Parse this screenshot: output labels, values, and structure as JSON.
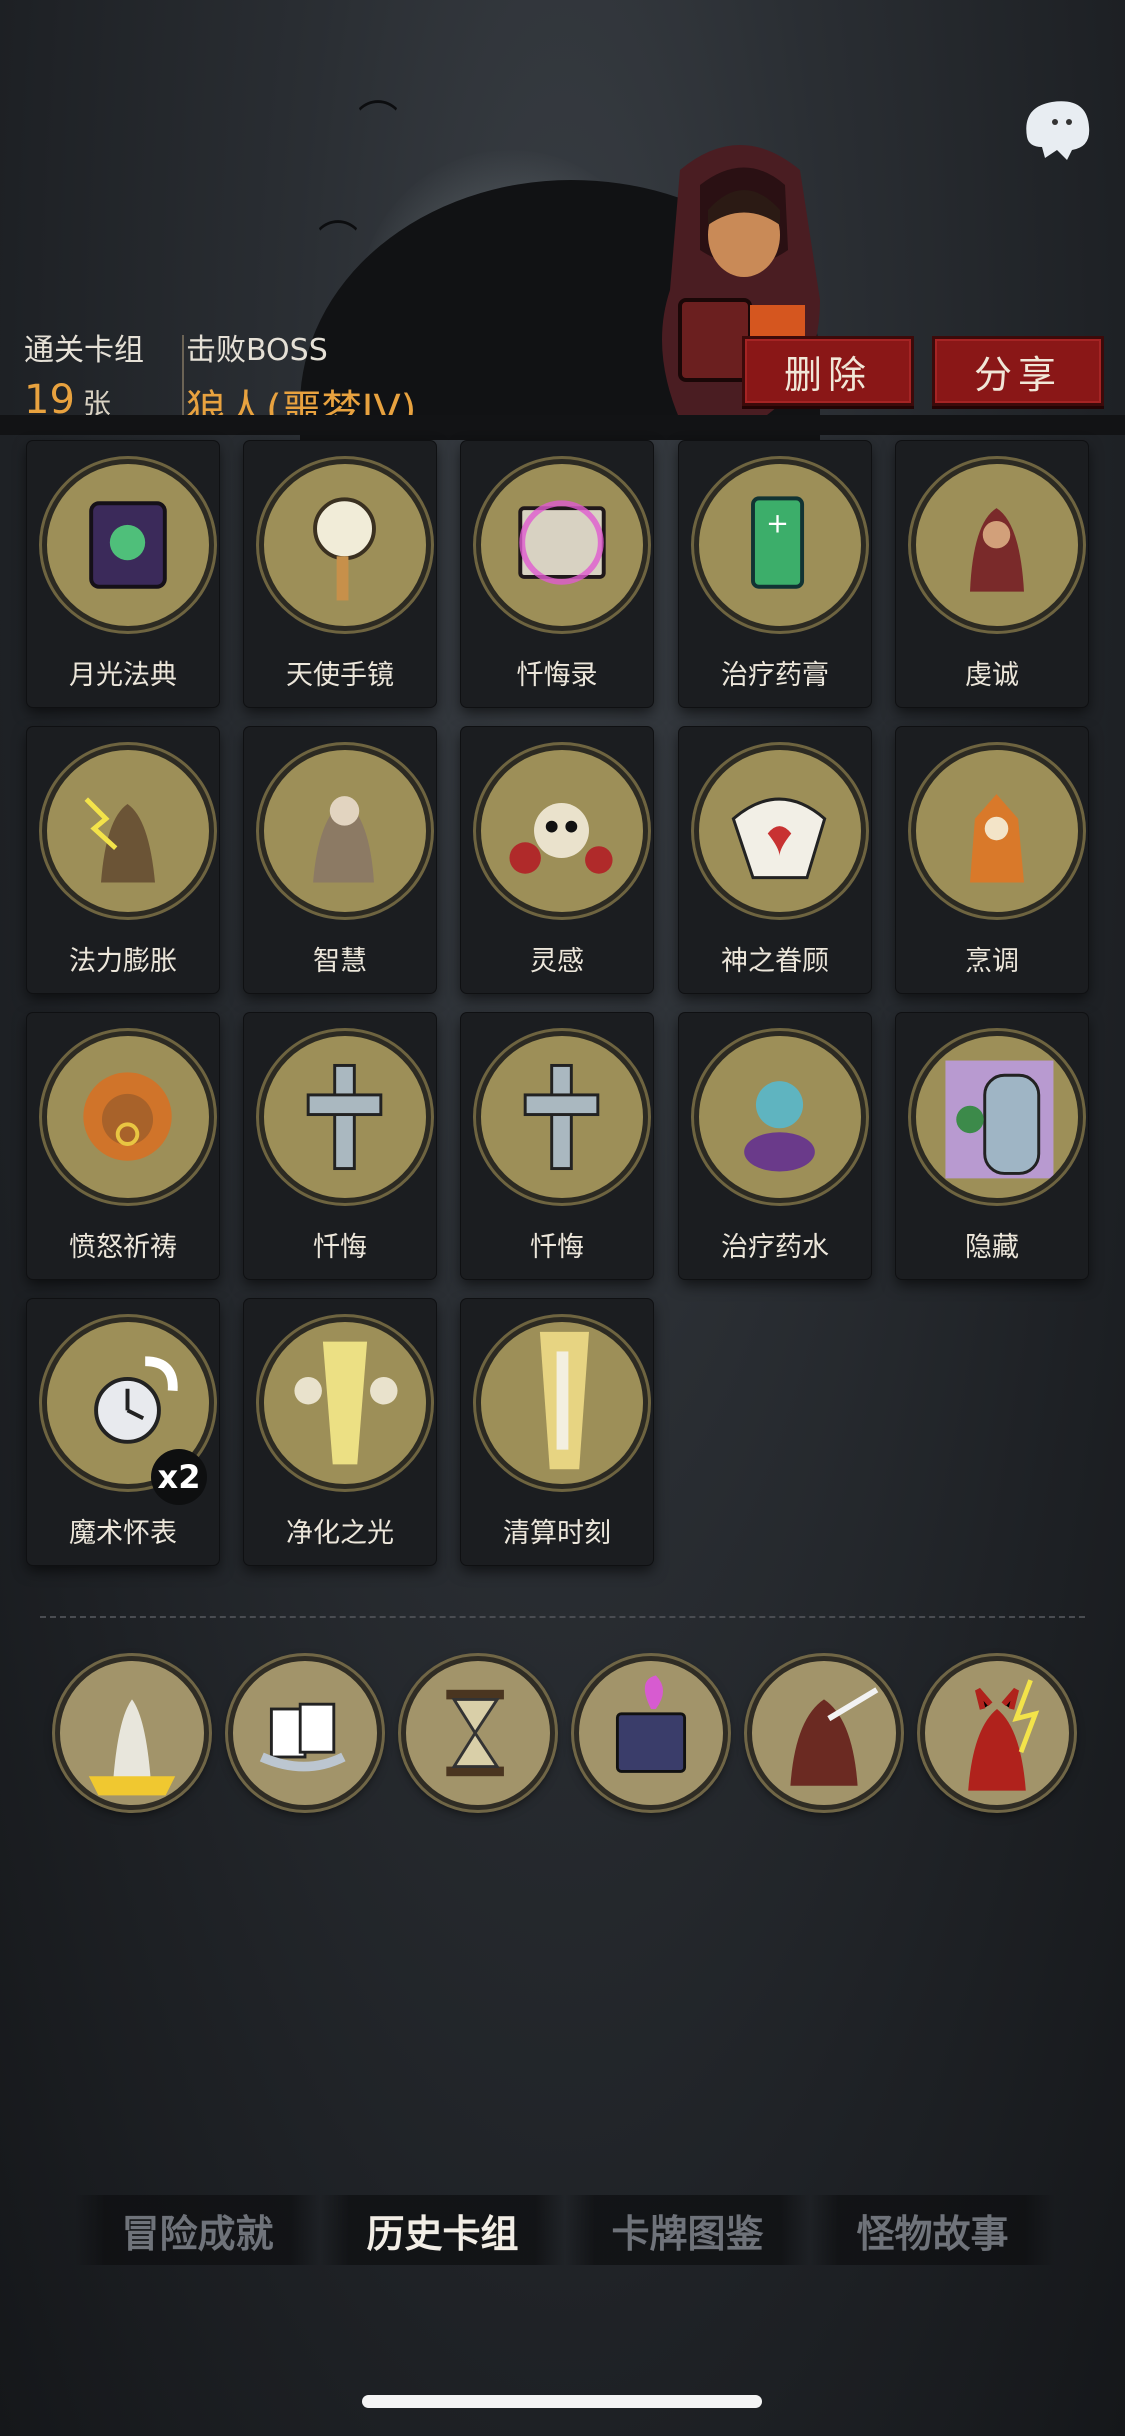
{
  "header": {
    "cleared_deck_label": "通关卡组",
    "cleared_deck_count": "19",
    "cleared_deck_unit": "张",
    "defeated_boss_label": "击败BOSS",
    "defeated_boss_name": "狼人(噩梦IV)",
    "delete_label": "删除",
    "share_label": "分享"
  },
  "cards": [
    {
      "name": "月光法典",
      "icon": "moonlight-codex-icon"
    },
    {
      "name": "天使手镜",
      "icon": "angel-hand-mirror-icon"
    },
    {
      "name": "忏悔录",
      "icon": "book-of-confessions-icon"
    },
    {
      "name": "治疗药膏",
      "icon": "healing-ointment-icon"
    },
    {
      "name": "虔诚",
      "icon": "piety-icon"
    },
    {
      "name": "法力膨胀",
      "icon": "mana-surge-icon"
    },
    {
      "name": "智慧",
      "icon": "wisdom-icon"
    },
    {
      "name": "灵感",
      "icon": "inspiration-icon"
    },
    {
      "name": "神之眷顾",
      "icon": "divine-favor-icon"
    },
    {
      "name": "烹调",
      "icon": "cooking-icon"
    },
    {
      "name": "愤怒祈祷",
      "icon": "wrathful-prayer-icon"
    },
    {
      "name": "忏悔",
      "icon": "repentance-cross-icon"
    },
    {
      "name": "忏悔",
      "icon": "repentance-cross-icon"
    },
    {
      "name": "治疗药水",
      "icon": "healing-potion-icon"
    },
    {
      "name": "隐藏",
      "icon": "hide-icon"
    },
    {
      "name": "魔术怀表",
      "icon": "magic-pocket-watch-icon",
      "badge": "x2"
    },
    {
      "name": "净化之光",
      "icon": "purifying-light-icon"
    },
    {
      "name": "清算时刻",
      "icon": "reckoning-sword-icon"
    }
  ],
  "relics": [
    {
      "icon": "angel-statue-relic-icon"
    },
    {
      "icon": "playing-cards-relic-icon"
    },
    {
      "icon": "hourglass-relic-icon"
    },
    {
      "icon": "cursed-tome-relic-icon"
    },
    {
      "icon": "hooded-warrior-relic-icon"
    },
    {
      "icon": "red-demon-relic-icon"
    }
  ],
  "tabs": [
    {
      "label": "冒险成就",
      "active": false
    },
    {
      "label": "历史卡组",
      "active": true
    },
    {
      "label": "卡牌图鉴",
      "active": false
    },
    {
      "label": "怪物故事",
      "active": false
    }
  ],
  "colors": {
    "accent_orange": "#e8a23f",
    "button_red": "#8a1717",
    "card_art_bg": "#9d8f58"
  }
}
